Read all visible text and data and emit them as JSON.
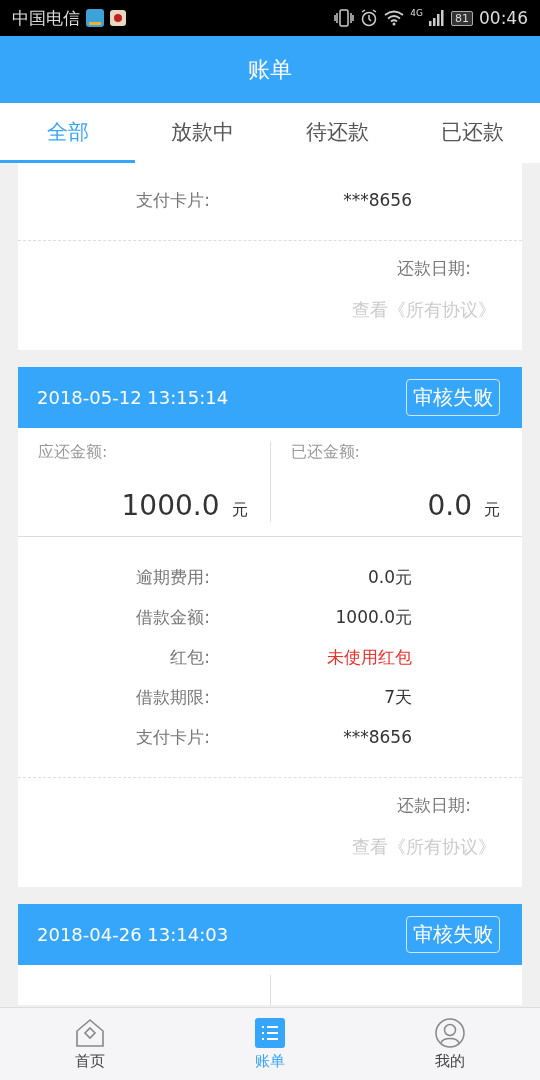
{
  "status_bar": {
    "carrier": "中国电信",
    "network": "4G",
    "battery": "81",
    "time": "00:46"
  },
  "header": {
    "title": "账单"
  },
  "tabs": [
    {
      "label": "全部",
      "selected": true
    },
    {
      "label": "放款中",
      "selected": false
    },
    {
      "label": "待还款",
      "selected": false
    },
    {
      "label": "已还款",
      "selected": false
    }
  ],
  "bills": [
    {
      "details": [
        {
          "label": "支付卡片:",
          "value": "***8656",
          "highlight": false
        }
      ],
      "due_label": "还款日期:",
      "agreement_link": "查看《所有协议》"
    },
    {
      "date": "2018-05-12 13:15:14",
      "status": "审核失败",
      "amount_due_label": "应还金额:",
      "amount_due": "1000.0",
      "amount_due_unit": "元",
      "amount_paid_label": "已还金额:",
      "amount_paid": "0.0",
      "amount_paid_unit": "元",
      "details": [
        {
          "label": "逾期费用:",
          "value": "0.0元",
          "highlight": false
        },
        {
          "label": "借款金额:",
          "value": "1000.0元",
          "highlight": false
        },
        {
          "label": "红包:",
          "value": "未使用红包",
          "highlight": true
        },
        {
          "label": "借款期限:",
          "value": "7天",
          "highlight": false
        },
        {
          "label": "支付卡片:",
          "value": "***8656",
          "highlight": false
        }
      ],
      "due_label": "还款日期:",
      "agreement_link": "查看《所有协议》"
    },
    {
      "date": "2018-04-26 13:14:03",
      "status": "审核失败"
    }
  ],
  "nav": [
    {
      "label": "首页",
      "kind": "home",
      "selected": false
    },
    {
      "label": "账单",
      "kind": "bill",
      "selected": true
    },
    {
      "label": "我的",
      "kind": "profile",
      "selected": false
    }
  ]
}
